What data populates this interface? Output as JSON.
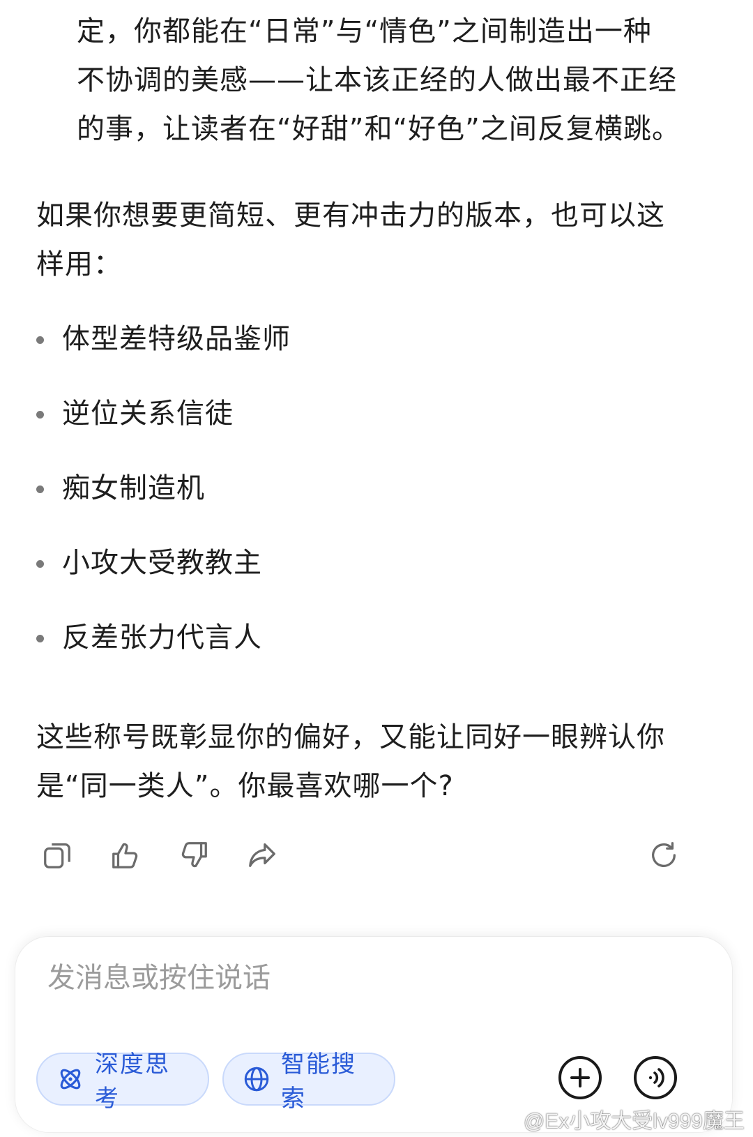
{
  "message": {
    "intro_lines": [
      "定，你都能在“日常”与“情色”之间制造出一种",
      "不协调的美感——让本该正经的人做出最不正经",
      "的事，让读者在“好甜”和“好色”之间反复横跳。"
    ],
    "para1_lines": [
      "如果你想要更简短、更有冲击力的版本，也可以这",
      "样用："
    ],
    "bullets": [
      "体型差特级品鉴师",
      "逆位关系信徒",
      "痴女制造机",
      "小攻大受教教主",
      "反差张力代言人"
    ],
    "para2_lines": [
      "这些称号既彰显你的偏好，又能让同好一眼辨认你",
      "是“同一类人”。你最喜欢哪一个?"
    ]
  },
  "actions": {
    "copy_icon": "copy-icon",
    "like_icon": "thumbs-up-icon",
    "dislike_icon": "thumbs-down-icon",
    "share_icon": "share-icon",
    "regenerate_icon": "refresh-icon"
  },
  "composer": {
    "placeholder": "发消息或按住说话",
    "chip_deep_think": "深度思考",
    "chip_web_search": "智能搜索"
  },
  "watermark": {
    "text": "@Ex小攻大受lv999魔王"
  },
  "colors": {
    "accent": "#2a5bd7",
    "chip_bg": "#e9f0ff",
    "text": "#1e1e1e"
  }
}
